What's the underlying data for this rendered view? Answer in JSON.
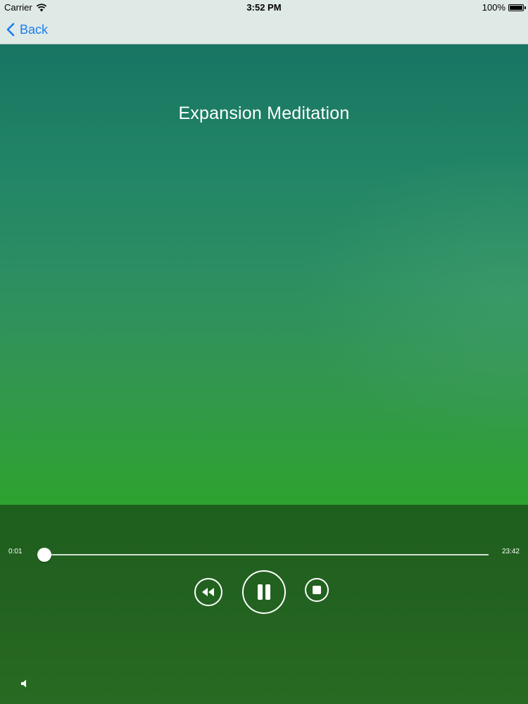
{
  "status_bar": {
    "carrier": "Carrier",
    "time": "3:52 PM",
    "battery": "100%",
    "icons": [
      "wifi-icon",
      "battery-icon"
    ]
  },
  "nav": {
    "back_label": "Back",
    "back_icon": "chevron-left-icon",
    "accent_color": "#1a7cf0"
  },
  "track": {
    "title": "Expansion Meditation"
  },
  "player": {
    "elapsed": "0:01",
    "total": "23:42",
    "progress_fraction": 0.0007,
    "controls": [
      "rewind-icon",
      "pause-icon",
      "stop-icon"
    ],
    "volume_icon": "speaker-icon"
  }
}
